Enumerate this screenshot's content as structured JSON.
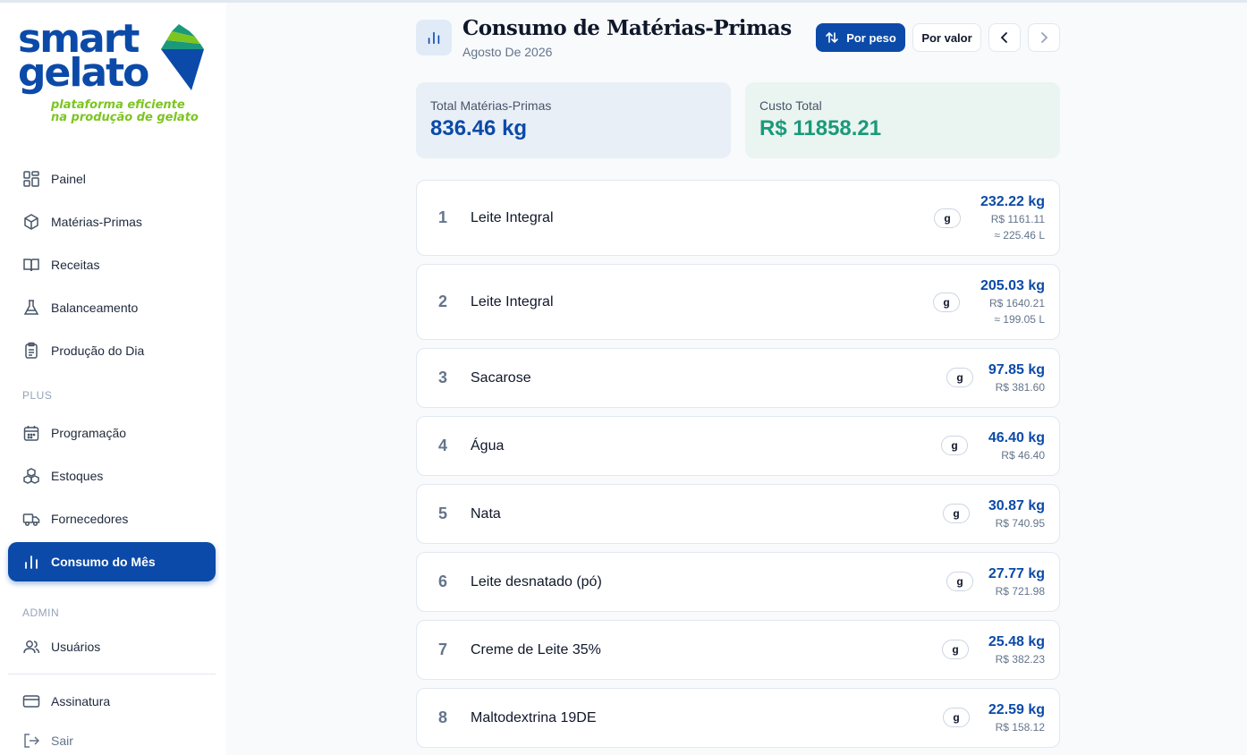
{
  "brand": {
    "word1": "smart",
    "word2": "gelato",
    "tagline1": "plataforma eficiente",
    "tagline2": "na produção de gelato",
    "colors": {
      "primary": "#0b4aa8",
      "accent": "#7cc520",
      "teal": "#1a9a7a"
    }
  },
  "sidebar": {
    "items": [
      {
        "label": "Painel",
        "icon": "dashboard-icon"
      },
      {
        "label": "Matérias-Primas",
        "icon": "box-icon"
      },
      {
        "label": "Receitas",
        "icon": "book-icon"
      },
      {
        "label": "Balanceamento",
        "icon": "flask-icon"
      },
      {
        "label": "Produção do Dia",
        "icon": "clipboard-icon"
      }
    ],
    "plus_label": "PLUS",
    "plus_items": [
      {
        "label": "Programação",
        "icon": "calendar-icon"
      },
      {
        "label": "Estoques",
        "icon": "boxes-icon"
      },
      {
        "label": "Fornecedores",
        "icon": "truck-icon"
      },
      {
        "label": "Consumo do Mês",
        "icon": "bar-chart-icon",
        "active": true
      }
    ],
    "admin_label": "ADMIN",
    "admin_items": [
      {
        "label": "Usuários",
        "icon": "users-icon"
      }
    ],
    "footer_items": [
      {
        "label": "Assinatura",
        "icon": "credit-card-icon"
      },
      {
        "label": "Sair",
        "icon": "logout-icon"
      }
    ]
  },
  "header": {
    "title": "Consumo de Matérias-Primas",
    "subtitle": "Agosto De 2026",
    "sort_by_weight": "Por peso",
    "sort_by_value": "Por valor"
  },
  "summary": {
    "total_label": "Total Matérias-Primas",
    "total_value": "836.46 kg",
    "cost_label": "Custo Total",
    "cost_value": "R$ 11858.21"
  },
  "rows": [
    {
      "rank": "1",
      "name": "Leite Integral",
      "unit": "g",
      "qty": "232.22 kg",
      "price": "R$ 1161.11",
      "liters": "≈ 225.46 L"
    },
    {
      "rank": "2",
      "name": "Leite Integral",
      "unit": "g",
      "qty": "205.03 kg",
      "price": "R$ 1640.21",
      "liters": "≈ 199.05 L"
    },
    {
      "rank": "3",
      "name": "Sacarose",
      "unit": "g",
      "qty": "97.85 kg",
      "price": "R$ 381.60"
    },
    {
      "rank": "4",
      "name": "Água",
      "unit": "g",
      "qty": "46.40 kg",
      "price": "R$ 46.40"
    },
    {
      "rank": "5",
      "name": "Nata",
      "unit": "g",
      "qty": "30.87 kg",
      "price": "R$ 740.95"
    },
    {
      "rank": "6",
      "name": "Leite desnatado (pó)",
      "unit": "g",
      "qty": "27.77 kg",
      "price": "R$ 721.98"
    },
    {
      "rank": "7",
      "name": "Creme de Leite 35%",
      "unit": "g",
      "qty": "25.48 kg",
      "price": "R$ 382.23"
    },
    {
      "rank": "8",
      "name": "Maltodextrina 19DE",
      "unit": "g",
      "qty": "22.59 kg",
      "price": "R$ 158.12"
    }
  ]
}
